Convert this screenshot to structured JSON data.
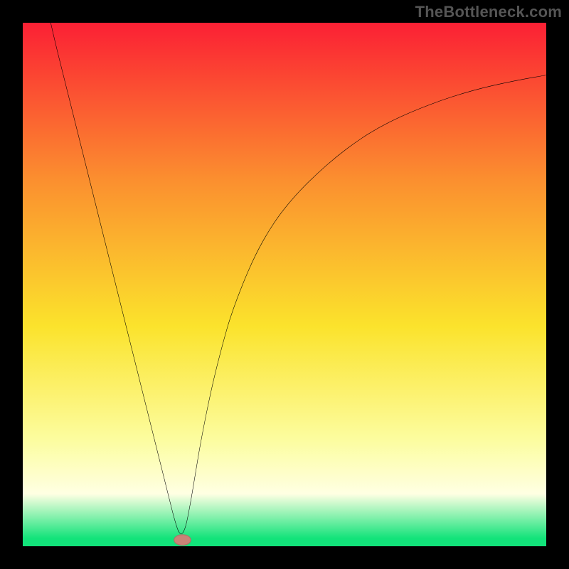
{
  "watermark": "TheBottleneck.com",
  "colors": {
    "black": "#000000",
    "grad_top": "#fb2034",
    "grad_mid_upper": "#fb8f2f",
    "grad_mid": "#fbe32c",
    "grad_lower": "#fcfda1",
    "grad_bottom_band": "#ffffe3",
    "grad_green": "#12e37a",
    "curve": "#000000",
    "marker_fill": "#c98377",
    "marker_stroke": "#b07067"
  },
  "chart_data": {
    "type": "line",
    "title": "",
    "xlabel": "",
    "ylabel": "",
    "xlim": [
      0,
      100
    ],
    "ylim": [
      0,
      100
    ],
    "series": [
      {
        "name": "bottleneck-curve",
        "x": [
          4,
          6,
          8,
          10,
          12,
          14,
          16,
          18,
          20,
          22,
          24,
          26,
          27,
          28,
          29,
          30,
          31,
          32,
          33,
          34,
          36,
          38,
          40,
          44,
          48,
          52,
          56,
          60,
          64,
          68,
          72,
          76,
          80,
          84,
          88,
          92,
          96,
          100
        ],
        "y": [
          106,
          97,
          89,
          81,
          73,
          65,
          57,
          49,
          41,
          33,
          25,
          17,
          13,
          9,
          5,
          2,
          3,
          8,
          14,
          20,
          30,
          38,
          45,
          55,
          62,
          67,
          71,
          74.5,
          77.5,
          80,
          82,
          83.7,
          85.2,
          86.5,
          87.6,
          88.5,
          89.3,
          90
        ]
      }
    ],
    "marker": {
      "x": 30.5,
      "y": 1.2,
      "rx": 1.6,
      "ry": 1.0
    },
    "background_gradient_stops": [
      {
        "offset": 0.0,
        "color_key": "grad_top"
      },
      {
        "offset": 0.3,
        "color_key": "grad_mid_upper"
      },
      {
        "offset": 0.58,
        "color_key": "grad_mid"
      },
      {
        "offset": 0.8,
        "color_key": "grad_lower"
      },
      {
        "offset": 0.9,
        "color_key": "grad_bottom_band"
      },
      {
        "offset": 0.985,
        "color_key": "grad_green"
      },
      {
        "offset": 1.0,
        "color_key": "grad_green"
      }
    ]
  }
}
